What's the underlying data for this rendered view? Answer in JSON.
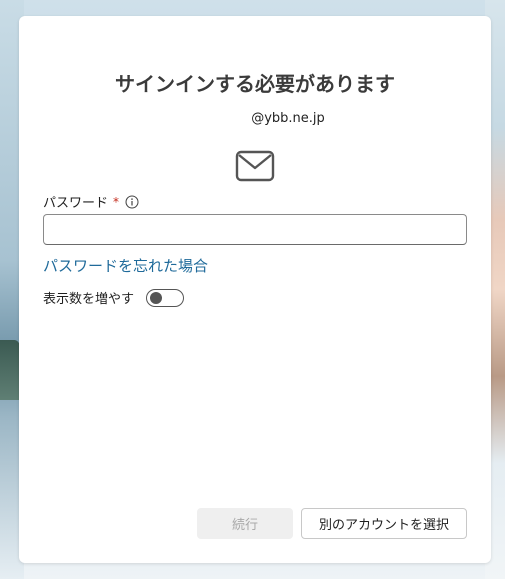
{
  "dialog": {
    "title": "サインインする必要があります",
    "email": "@ybb.ne.jp",
    "icon": "mail-icon"
  },
  "password": {
    "label": "パスワード",
    "required_mark": "*",
    "value": "",
    "placeholder": "",
    "info_icon": "info-icon"
  },
  "forgot_password_link": "パスワードを忘れた場合",
  "show_more": {
    "label": "表示数を増やす",
    "toggle_on": false
  },
  "buttons": {
    "continue": "続行",
    "choose_other_account": "別のアカウントを選択"
  }
}
